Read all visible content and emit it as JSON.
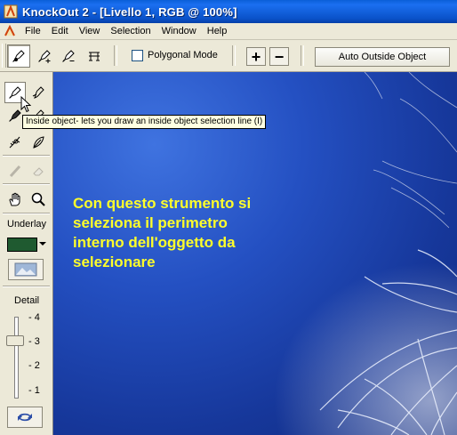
{
  "window": {
    "title": "KnockOut 2 - [Livello 1, RGB @ 100%]"
  },
  "menu": {
    "items": [
      "File",
      "Edit",
      "View",
      "Selection",
      "Window",
      "Help"
    ]
  },
  "toolbar": {
    "polygonal_mode_label": "Polygonal Mode",
    "polygonal_mode_checked": false,
    "plus_label": "+",
    "minus_label": "−",
    "auto_outside_label": "Auto Outside Object"
  },
  "tools": {
    "underlay_label": "Underlay",
    "underlay_color": "#1f5a30",
    "detail_label": "Detail",
    "detail_ticks": [
      "- 4",
      "- 3",
      "- 2",
      "- 1"
    ],
    "detail_value": 3
  },
  "tooltip": {
    "text": "Inside object- lets you draw an inside object selection line (I)"
  },
  "canvas": {
    "caption_lines": [
      "Con questo strumento si",
      "seleziona il perimetro",
      "interno dell'oggetto da",
      "selezionare"
    ],
    "caption_color": "#ffff2a",
    "background_color": "#2450c2"
  },
  "icons": {
    "app": "knockout-logo-icon",
    "inside_object_tool": "inside-object-icon",
    "outside_object_tool": "outside-object-icon"
  }
}
